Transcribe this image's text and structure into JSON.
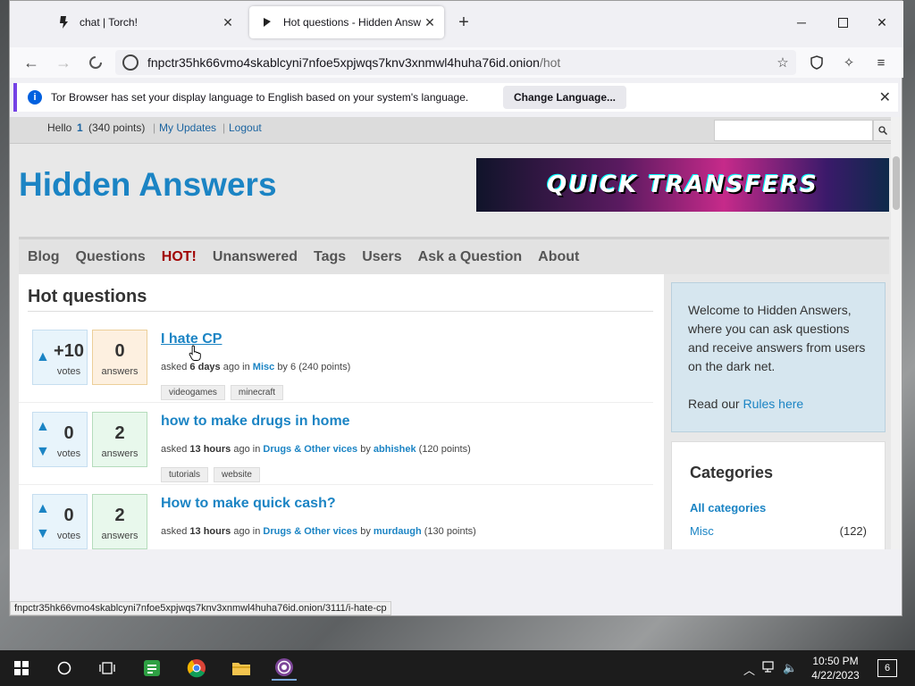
{
  "tabs": [
    {
      "label": "chat | Torch!",
      "icon": "torch-favicon-icon"
    },
    {
      "label": "Hot questions - Hidden Answe",
      "icon": "hidden-answers-favicon-icon"
    }
  ],
  "address": {
    "host": "fnpctr35hk66vmo4skablcyni7nfoe5xpjwqs7knv3xnmwl4huha76id.onion",
    "path": "/hot"
  },
  "notification": {
    "message": "Tor Browser has set your display language to English based on your system's language.",
    "button": "Change Language..."
  },
  "userbar": {
    "hello": "Hello",
    "user": "1",
    "points": "(340 points)",
    "my_updates": "My Updates",
    "logout": "Logout",
    "sep": "|"
  },
  "site": {
    "title": "Hidden Answers",
    "banner": "QUICK TRANSFERS"
  },
  "menu": [
    "Blog",
    "Questions",
    "HOT!",
    "Unanswered",
    "Tags",
    "Users",
    "Ask a Question",
    "About"
  ],
  "page_heading": "Hot questions",
  "questions": [
    {
      "votes": "+10",
      "votes_label": "votes",
      "answers": "0",
      "answers_label": "answers",
      "title": "I hate CP",
      "asked": "asked",
      "when": "6 days",
      "ago_in": "ago in",
      "category": "Misc",
      "by": "by",
      "author": "6",
      "author_points": "(240 points)",
      "tags": [
        "videogames",
        "minecraft"
      ]
    },
    {
      "votes": "0",
      "votes_label": "votes",
      "answers": "2",
      "answers_label": "answers",
      "title": "how to make drugs in home",
      "asked": "asked",
      "when": "13 hours",
      "ago_in": "ago in",
      "category": "Drugs & Other vices",
      "by": "by",
      "author": "abhishek",
      "author_points": "(120 points)",
      "tags": [
        "tutorials",
        "website"
      ]
    },
    {
      "votes": "0",
      "votes_label": "votes",
      "answers": "2",
      "answers_label": "answers",
      "title": "How to make quick cash?",
      "asked": "asked",
      "when": "13 hours",
      "ago_in": "ago in",
      "category": "Drugs & Other vices",
      "by": "by",
      "author": "murdaugh",
      "author_points": "(130 points)",
      "tags": []
    }
  ],
  "welcome": {
    "text": "Welcome to Hidden Answers, where you can ask questions and receive answers from users on the dark net.",
    "read_our": "Read our",
    "rules_link": "Rules here"
  },
  "categories": {
    "title": "Categories",
    "all": "All categories",
    "items": [
      {
        "name": "Misc",
        "count": "(122)"
      }
    ]
  },
  "status_url": "fnpctr35hk66vmo4skablcyni7nfoe5xpjwqs7knv3xnmwl4huha76id.onion/3111/i-hate-cp",
  "clock": {
    "time": "10:50 PM",
    "date": "4/22/2023"
  },
  "notification_count": "6",
  "colors": {
    "link": "#1b84c4",
    "hot": "#a00000",
    "accent": "#7542e5"
  }
}
